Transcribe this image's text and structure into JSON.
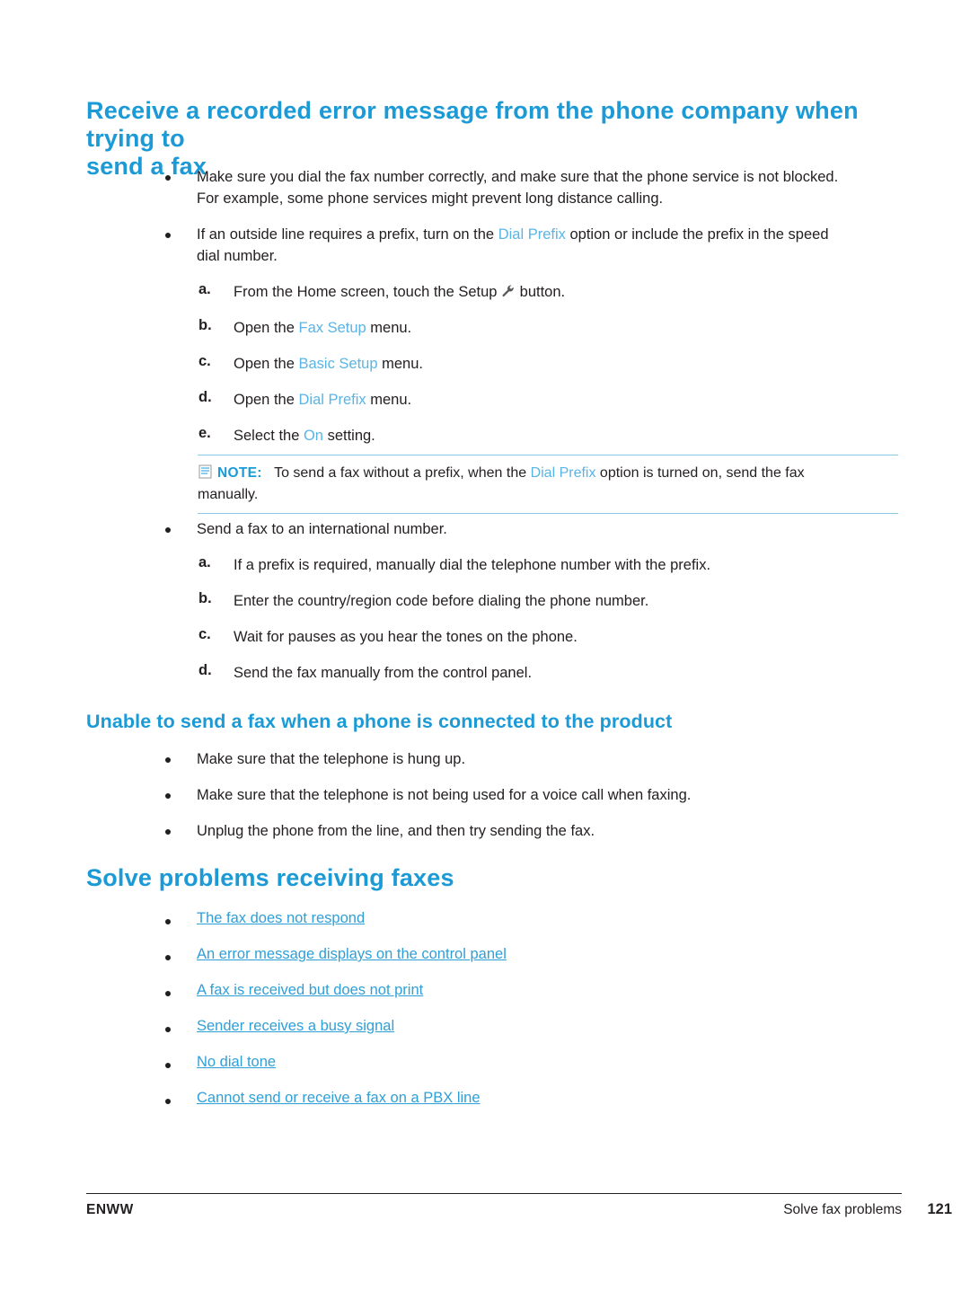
{
  "heading1": {
    "line1": "Receive a recorded error message from the phone company when trying to",
    "line2": "send a fax"
  },
  "bullets1": [
    {
      "text_line1": "Make sure you dial the fax number correctly, and make sure that the phone service is not blocked.",
      "text_line2": "For example, some phone services might prevent long distance calling."
    }
  ],
  "bullet2": {
    "pre": "If an outside line requires a prefix, turn on the ",
    "term": "Dial Prefix",
    "post": " option or include the prefix in the speed",
    "line2": "dial number."
  },
  "steps1": [
    {
      "label": "a.",
      "pre": "From the Home screen, touch the Setup ",
      "term": "",
      "post": " button."
    },
    {
      "label": "b.",
      "pre": "Open the ",
      "term": "Fax Setup",
      "post": " menu."
    },
    {
      "label": "c.",
      "pre": "Open the ",
      "term": "Basic Setup",
      "post": " menu."
    },
    {
      "label": "d.",
      "pre": "Open the ",
      "term": "Dial Prefix",
      "post": " menu."
    },
    {
      "label": "e.",
      "pre": "Select the ",
      "term": "On",
      "post": " setting."
    }
  ],
  "note": {
    "label": "NOTE:",
    "pre": "To send a fax without a prefix, when the ",
    "term": "Dial Prefix",
    "post": " option is turned on, send the fax",
    "line2": "manually."
  },
  "bullet3": {
    "text": "Send a fax to an international number."
  },
  "steps2": [
    {
      "label": "a.",
      "text": "If a prefix is required, manually dial the telephone number with the prefix."
    },
    {
      "label": "b.",
      "text": "Enter the country/region code before dialing the phone number."
    },
    {
      "label": "c.",
      "text": "Wait for pauses as you hear the tones on the phone."
    },
    {
      "label": "d.",
      "text": "Send the fax manually from the control panel."
    }
  ],
  "heading2": "Unable to send a fax when a phone is connected to the product",
  "bullets2": [
    "Make sure that the telephone is hung up.",
    "Make sure that the telephone is not being used for a voice call when faxing.",
    "Unplug the phone from the line, and then try sending the fax."
  ],
  "heading3": "Solve problems receiving faxes",
  "links": [
    "The fax does not respond",
    "An error message displays on the control panel",
    "A fax is received but does not print",
    "Sender receives a busy signal",
    "No dial tone",
    "Cannot send or receive a fax on a PBX line"
  ],
  "footer": {
    "left": "ENWW",
    "right": "Solve fax problems",
    "page": "121"
  },
  "colors": {
    "accent": "#1b9ad6",
    "link": "#2f9fd8",
    "ui_term": "#5ab4e5",
    "text": "#231f20"
  }
}
